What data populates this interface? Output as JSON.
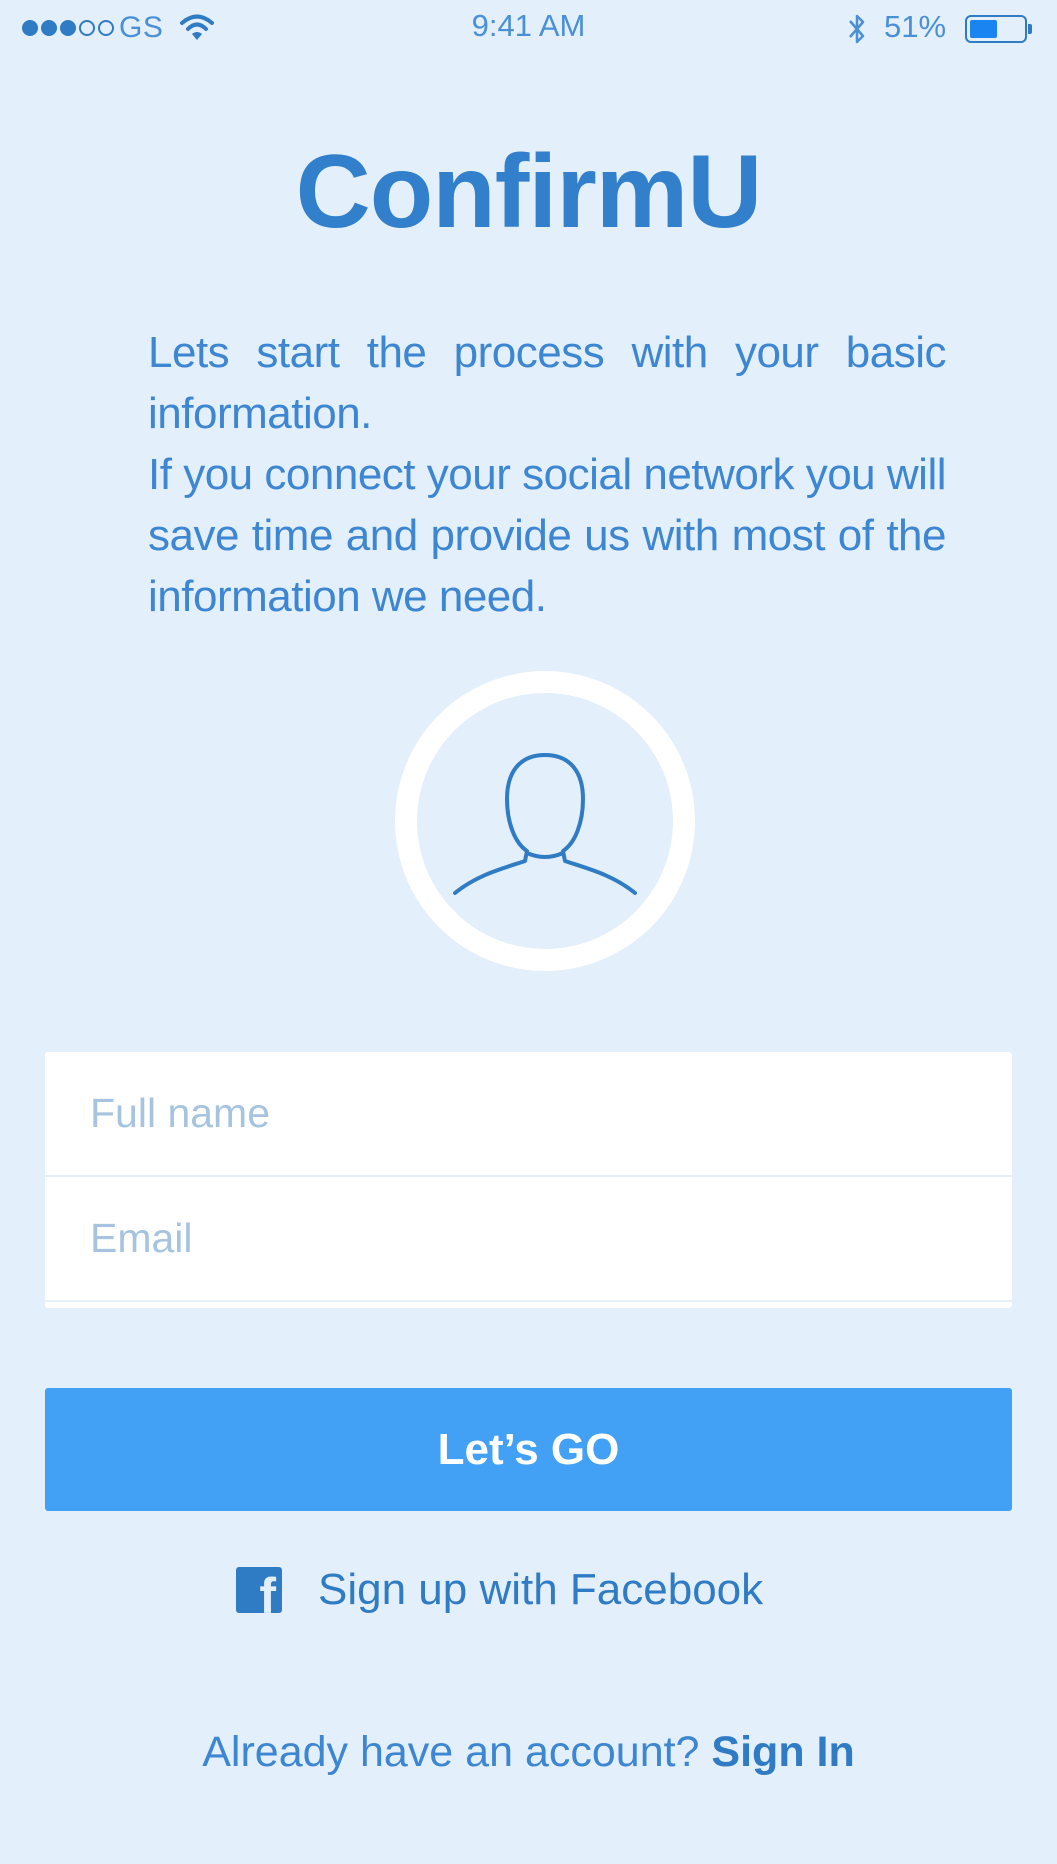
{
  "status_bar": {
    "carrier": "GS",
    "time": "9:41 AM",
    "battery_percent": "51%",
    "battery_level": 0.51,
    "signal_bars_filled": 3,
    "signal_bars_total": 5
  },
  "app": {
    "title": "ConfirmU"
  },
  "intro": {
    "line1": "Lets start the process with your basic information.",
    "line2": "If you connect your social network you will save time and provide us with most of the information we need."
  },
  "avatar": {
    "icon": "user-silhouette-icon"
  },
  "form": {
    "full_name_placeholder": "Full name",
    "email_placeholder": "Email"
  },
  "actions": {
    "go_label": "Let’s GO",
    "facebook_label": "Sign up with Facebook",
    "facebook_icon": "facebook-icon"
  },
  "signin": {
    "prompt": "Already have an account?",
    "link_label": "Sign In"
  },
  "colors": {
    "background": "#e3effa",
    "primary": "#42a1f5",
    "brand_blue": "#2f7bc4",
    "placeholder": "#a6c3e0"
  }
}
